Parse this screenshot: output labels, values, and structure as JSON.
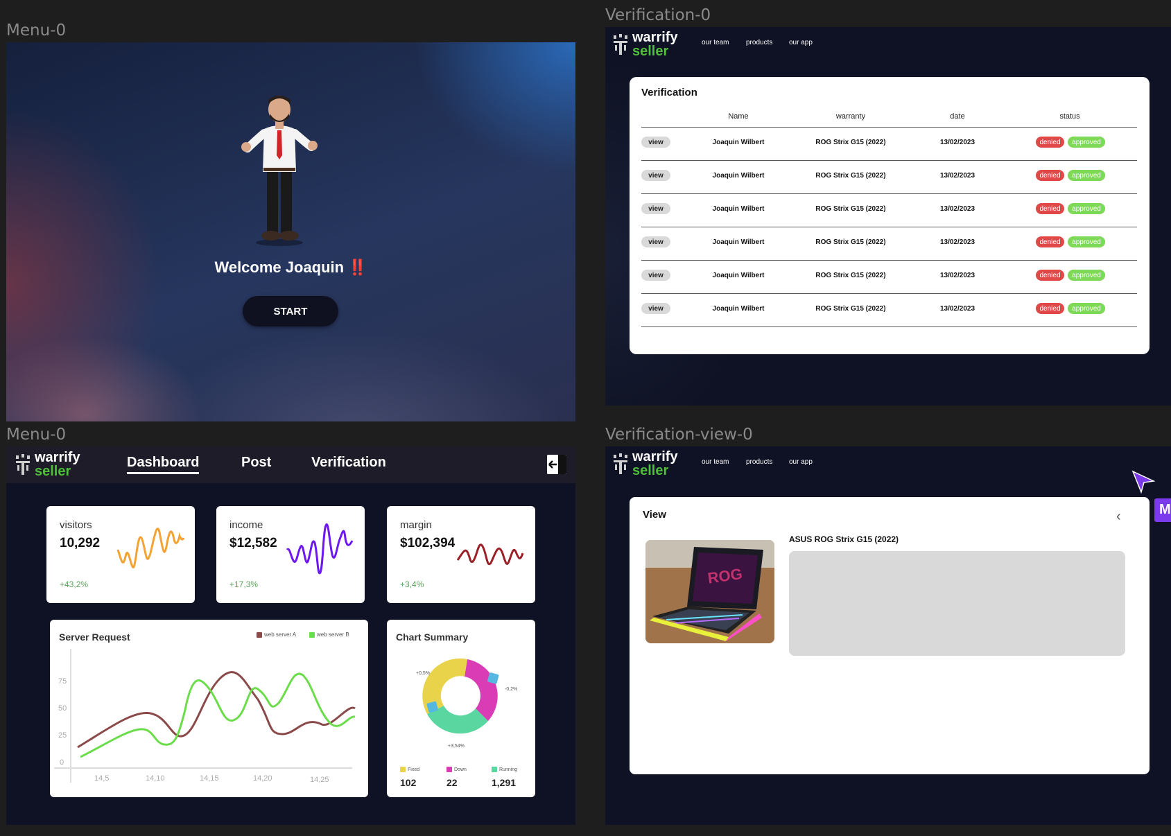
{
  "frames": {
    "welcome": {
      "label": "Menu-0",
      "text": "Welcome Joaquin",
      "emphasis": "‼️",
      "start_label": "START"
    },
    "dashboard": {
      "label": "Menu-0"
    },
    "verification": {
      "label": "Verification-0"
    },
    "verification_view": {
      "label": "Verification-view-0"
    }
  },
  "brand": {
    "line1": "warrify",
    "line2": "seller"
  },
  "dashboard": {
    "nav": [
      "Dashboard",
      "Post",
      "Verification"
    ],
    "active_nav": "Dashboard",
    "stats": [
      {
        "label": "visitors",
        "value": "10,292",
        "change": "+43,2%",
        "color": "#f4a233"
      },
      {
        "label": "income",
        "value": "$12,582",
        "change": "+17,3%",
        "color": "#6d18f0"
      },
      {
        "label": "margin",
        "value": "$102,394",
        "change": "+3,4%",
        "color": "#9b1f26"
      }
    ],
    "server_request": {
      "title": "Server Request",
      "legend": [
        {
          "name": "web server A",
          "color": "#8b4a4a"
        },
        {
          "name": "web server B",
          "color": "#6bdc4a"
        }
      ],
      "yticks": [
        "0",
        "25",
        "50",
        "75"
      ],
      "xticks": [
        "14,5",
        "14,10",
        "14,15",
        "14,20",
        "14,25"
      ]
    },
    "chart_summary": {
      "title": "Chart Summary",
      "annotations": [
        "+0,5%",
        "-0,2%",
        "+3,54%"
      ],
      "legend": [
        {
          "name": "Fixed",
          "value": "102",
          "color": "#e9d34b"
        },
        {
          "name": "Down",
          "value": "22",
          "color": "#d93cb4"
        },
        {
          "name": "Running",
          "value": "1,291",
          "color": "#5ad6a0"
        }
      ]
    }
  },
  "chart_data": [
    {
      "type": "line",
      "title": "Server Request",
      "x": [
        "14,5",
        "14,10",
        "14,15",
        "14,20",
        "14,25"
      ],
      "ylim": [
        0,
        100
      ],
      "series": [
        {
          "name": "web server A",
          "values": [
            10,
            50,
            38,
            90,
            25,
            85,
            35,
            60,
            48
          ]
        },
        {
          "name": "web server B",
          "values": [
            2,
            30,
            15,
            82,
            50,
            70,
            38,
            87,
            35,
            42
          ]
        }
      ]
    },
    {
      "type": "pie",
      "title": "Chart Summary",
      "categories": [
        "Fixed",
        "Down",
        "Running"
      ],
      "values": [
        102,
        22,
        1291
      ]
    }
  ],
  "verification": {
    "nav": [
      "our team",
      "products",
      "our app"
    ],
    "title": "Verification",
    "columns": [
      "Name",
      "warranty",
      "date",
      "status"
    ],
    "rows": [
      {
        "action": "view",
        "name": "Joaquin Wilbert",
        "warranty": "ROG Strix G15 (2022)",
        "date": "13/02/2023",
        "deny": "denied",
        "approve": "approved"
      },
      {
        "action": "view",
        "name": "Joaquin Wilbert",
        "warranty": "ROG Strix G15 (2022)",
        "date": "13/02/2023",
        "deny": "denied",
        "approve": "approved"
      },
      {
        "action": "view",
        "name": "Joaquin Wilbert",
        "warranty": "ROG Strix G15 (2022)",
        "date": "13/02/2023",
        "deny": "denied",
        "approve": "approved"
      },
      {
        "action": "view",
        "name": "Joaquin Wilbert",
        "warranty": "ROG Strix G15 (2022)",
        "date": "13/02/2023",
        "deny": "denied",
        "approve": "approved"
      },
      {
        "action": "view",
        "name": "Joaquin Wilbert",
        "warranty": "ROG Strix G15 (2022)",
        "date": "13/02/2023",
        "deny": "denied",
        "approve": "approved"
      },
      {
        "action": "view",
        "name": "Joaquin Wilbert",
        "warranty": "ROG Strix G15 (2022)",
        "date": "13/02/2023",
        "deny": "denied",
        "approve": "approved"
      }
    ]
  },
  "verification_view": {
    "nav": [
      "our team",
      "products",
      "our app"
    ],
    "title": "View",
    "back_icon": "chevron-left-icon",
    "product_name": "ASUS ROG Strix G15 (2022)",
    "cursor_tag": "M"
  }
}
